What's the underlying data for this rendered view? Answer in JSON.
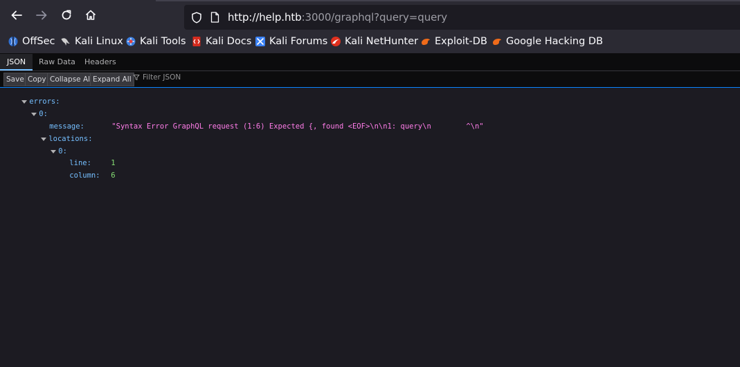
{
  "browser": {
    "url_host": "http://help.htb",
    "url_rest": ":3000/graphql?query=query"
  },
  "bookmarks": [
    {
      "label": "OffSec",
      "icon": "offsec-icon",
      "color": "#3a7bd5"
    },
    {
      "label": "Kali Linux",
      "icon": "kali-dragon-icon",
      "color": "#cfcfcf"
    },
    {
      "label": "Kali Tools",
      "icon": "kali-tools-icon",
      "color": "#4a90e2"
    },
    {
      "label": "Kali Docs",
      "icon": "kali-docs-icon",
      "color": "#d52b1e"
    },
    {
      "label": "Kali Forums",
      "icon": "kali-forums-icon",
      "color": "#3b82f6"
    },
    {
      "label": "Kali NetHunter",
      "icon": "nethunter-icon",
      "color": "#e0301e"
    },
    {
      "label": "Exploit-DB",
      "icon": "exploitdb-icon",
      "color": "#ef6b1a"
    },
    {
      "label": "Google Hacking DB",
      "icon": "ghdb-icon",
      "color": "#ef6b1a"
    }
  ],
  "devtools": {
    "tabs": [
      "JSON",
      "Raw Data",
      "Headers"
    ],
    "buttons": [
      "Save",
      "Copy",
      "Collapse All",
      "Expand All"
    ],
    "filter_placeholder": "Filter JSON"
  },
  "json": {
    "errors_key": "errors:",
    "idx0_key": "0:",
    "message_key": "message:",
    "message_value": "\"Syntax Error GraphQL request (1:6) Expected {, found <EOF>\\n\\n1: query\\n        ^\\n\"",
    "locations_key": "locations:",
    "loc0_key": "0:",
    "line_key": "line:",
    "line_value": "1",
    "column_key": "column:",
    "column_value": "6"
  }
}
